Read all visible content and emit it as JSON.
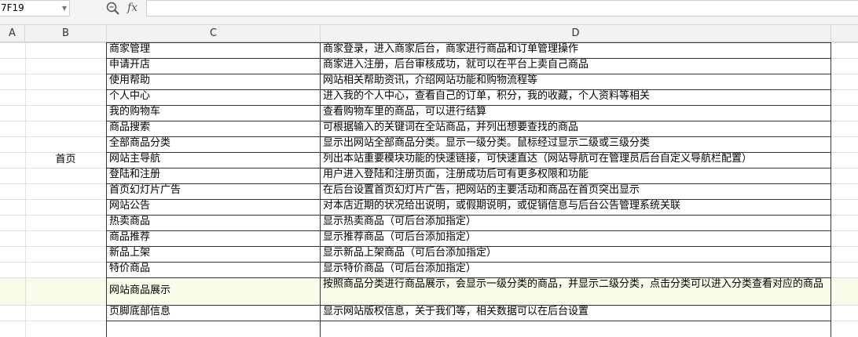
{
  "formula_bar": {
    "cell_ref": "7F19",
    "zoom_icon": "zoom-icon",
    "fx_label": "fx",
    "formula": ""
  },
  "columns": [
    "A",
    "B",
    "C",
    "D"
  ],
  "sheet": {
    "merged_b_label": "首页",
    "rows": [
      {
        "c": "商家管理",
        "d": "商家登录，进入商家后台，商家进行商品和订单管理操作"
      },
      {
        "c": "申请开店",
        "d": "商家进入注册，后台审核成功，就可以在平台上卖自己商品"
      },
      {
        "c": "使用帮助",
        "d": "网站相关帮助资讯，介绍网站功能和购物流程等"
      },
      {
        "c": "个人中心",
        "d": "进入我的个人中心，查看自己的订单，积分，我的收藏，个人资料等相关"
      },
      {
        "c": "我的购物车",
        "d": "查看购物车里的商品，可以进行结算"
      },
      {
        "c": "商品搜索",
        "d": "可根据输入的关键词在全站商品，并列出想要查找的商品"
      },
      {
        "c": "全部商品分类",
        "d": "显示出网站全部商品分类。显示一级分类。鼠标经过显示二级或三级分类"
      },
      {
        "c": "网站主导航",
        "d": "列出本站重要模块功能的快速链接，可快速直达（网站导航可在管理员后台自定义导航栏配置）"
      },
      {
        "c": "登陆和注册",
        "d": "用户进入登陆和注册页面，注册成功后可有更多权限和功能"
      },
      {
        "c": "首页幻灯片广告",
        "d": "在后台设置首页幻灯片广告，把网站的主要活动和商品在首页突出显示"
      },
      {
        "c": "网站公告",
        "d": "对本店近期的状况给出说明，或假期说明，或促销信息与后台公告管理系统关联"
      },
      {
        "c": "热卖商品",
        "d": "显示热卖商品（可后台添加指定）"
      },
      {
        "c": "商品推荐",
        "d": "显示推荐商品（可后台添加指定）"
      },
      {
        "c": "新品上架",
        "d": "显示新品上架商品（可后台添加指定）"
      },
      {
        "c": "特价商品",
        "d": "显示特价商品（可后台添加指定）"
      },
      {
        "c": "网站商品展示",
        "d": "按照商品分类进行商品展示，会显示一级分类的商品，并显示二级分类，点击分类可以进入分类查看对应的商品"
      },
      {
        "c": "页脚底部信息",
        "d": "显示网站版权信息，关于我们等，相关数据可以在后台设置"
      }
    ]
  }
}
